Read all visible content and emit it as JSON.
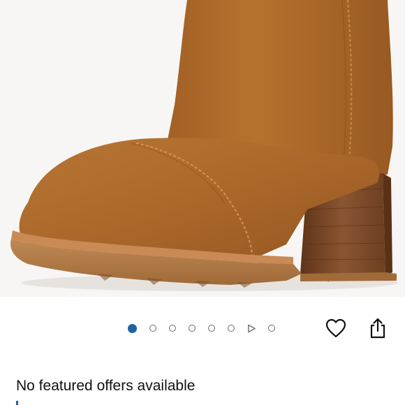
{
  "product": {
    "image_alt": "Brown suede ankle boot with stacked block heel",
    "gallery": {
      "total_items": 8,
      "active_index": 0,
      "video_index": 6
    },
    "colors": {
      "suede": "#b5702f",
      "heel_wood": "#7c4a2b",
      "sole": "#b17a45",
      "active_dot": "#2162a1"
    }
  },
  "actions": {
    "favorite_icon": "heart-icon",
    "share_icon": "share-icon"
  },
  "offers": {
    "status_text": "No featured offers available"
  }
}
